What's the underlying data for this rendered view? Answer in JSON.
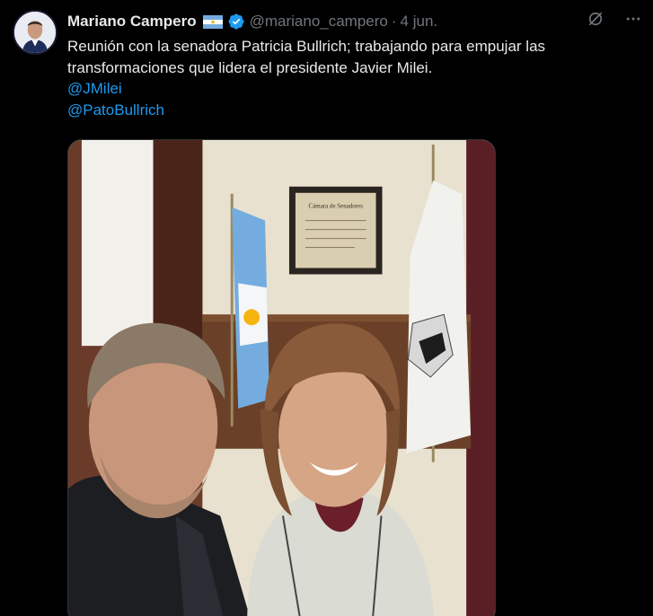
{
  "author": {
    "name": "Mariano Campero",
    "handle": "@mariano_campero",
    "separator": "·",
    "date": "4 jun."
  },
  "icons": {
    "avatar": "avatar-photo",
    "flag": "argentina-flag-icon",
    "verified": "verified-badge-icon",
    "grok": "grok-icon",
    "more": "more-options-icon"
  },
  "tweet": {
    "text": "Reunión con la senadora Patricia Bullrich; trabajando para empujar las transformaciones que lidera el presidente Javier Milei.",
    "mentions": [
      "@JMilei",
      "@PatoBullrich"
    ]
  },
  "media": {
    "certificate_title": "Cámara de Senadores"
  },
  "colors": {
    "background": "#000000",
    "text": "#e7e9ea",
    "secondary": "#71767b",
    "link": "#1d9bf0",
    "verified": "#1d9bf0"
  }
}
